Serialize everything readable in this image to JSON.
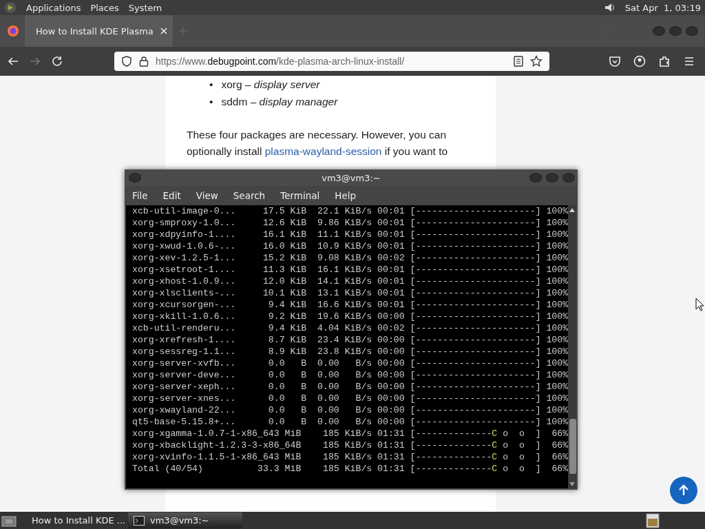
{
  "top_panel": {
    "menus": [
      "Applications",
      "Places",
      "System"
    ],
    "clock": "Sat Apr  1, 03:19"
  },
  "browser": {
    "tabs": [
      {
        "title": "How to Install KDE Plasma",
        "selected": true
      }
    ],
    "url": {
      "prefix": "https://www.",
      "domain": "debugpoint.com",
      "path": "/kde-plasma-arch-linux-install/"
    },
    "forward_disabled": true
  },
  "article": {
    "bullets": [
      {
        "marker": "•",
        "text": "xorg – *display server*"
      },
      {
        "marker": "•",
        "text": "sddm – *display manager*"
      }
    ],
    "paragraph": {
      "before": "These four packages are necessary. However, you can optionally install ",
      "link": "plasma-wayland-session",
      "after": " if you want to"
    }
  },
  "terminal": {
    "title": "vm3@vm3:~",
    "menu": [
      "File",
      "Edit",
      "View",
      "Search",
      "Terminal",
      "Help"
    ],
    "lines": [
      {
        "kind": "done",
        "info": "xcb-util-image-0...     17.5 KiB  22.1 KiB/s 00:01 ",
        "bar": "[----------------------]",
        "percent": " 100%"
      },
      {
        "kind": "done",
        "info": "xorg-smproxy-1.0...     12.6 KiB  9.86 KiB/s 00:01 ",
        "bar": "[----------------------]",
        "percent": " 100%"
      },
      {
        "kind": "done",
        "info": "xorg-xdpyinfo-1....     16.1 KiB  11.1 KiB/s 00:01 ",
        "bar": "[----------------------]",
        "percent": " 100%"
      },
      {
        "kind": "done",
        "info": "xorg-xwud-1.0.6-...     16.0 KiB  10.9 KiB/s 00:01 ",
        "bar": "[----------------------]",
        "percent": " 100%"
      },
      {
        "kind": "done",
        "info": "xorg-xev-1.2.5-1...     15.2 KiB  9.08 KiB/s 00:02 ",
        "bar": "[----------------------]",
        "percent": " 100%"
      },
      {
        "kind": "done",
        "info": "xorg-xsetroot-1....     11.3 KiB  16.1 KiB/s 00:01 ",
        "bar": "[----------------------]",
        "percent": " 100%"
      },
      {
        "kind": "done",
        "info": "xorg-xhost-1.0.9...     12.0 KiB  14.1 KiB/s 00:01 ",
        "bar": "[----------------------]",
        "percent": " 100%"
      },
      {
        "kind": "done",
        "info": "xorg-xlsclients-...     10.1 KiB  13.1 KiB/s 00:01 ",
        "bar": "[----------------------]",
        "percent": " 100%"
      },
      {
        "kind": "done",
        "info": "xorg-xcursorgen-...      9.4 KiB  16.6 KiB/s 00:01 ",
        "bar": "[----------------------]",
        "percent": " 100%"
      },
      {
        "kind": "done",
        "info": "xorg-xkill-1.0.6...      9.2 KiB  19.6 KiB/s 00:00 ",
        "bar": "[----------------------]",
        "percent": " 100%"
      },
      {
        "kind": "done",
        "info": "xcb-util-renderu...      9.4 KiB  4.04 KiB/s 00:02 ",
        "bar": "[----------------------]",
        "percent": " 100%"
      },
      {
        "kind": "done",
        "info": "xorg-xrefresh-1....      8.7 KiB  23.4 KiB/s 00:00 ",
        "bar": "[----------------------]",
        "percent": " 100%"
      },
      {
        "kind": "done",
        "info": "xorg-sessreg-1.1...      8.9 KiB  23.8 KiB/s 00:00 ",
        "bar": "[----------------------]",
        "percent": " 100%"
      },
      {
        "kind": "done",
        "info": "xorg-server-xvfb...      0.0   B  0.00   B/s 00:00 ",
        "bar": "[----------------------]",
        "percent": " 100%"
      },
      {
        "kind": "done",
        "info": "xorg-server-deve...      0.0   B  0.00   B/s 00:00 ",
        "bar": "[----------------------]",
        "percent": " 100%"
      },
      {
        "kind": "done",
        "info": "xorg-server-xeph...      0.0   B  0.00   B/s 00:00 ",
        "bar": "[----------------------]",
        "percent": " 100%"
      },
      {
        "kind": "done",
        "info": "xorg-server-xnes...      0.0   B  0.00   B/s 00:00 ",
        "bar": "[----------------------]",
        "percent": " 100%"
      },
      {
        "kind": "done",
        "info": "xorg-xwayland-22...      0.0   B  0.00   B/s 00:00 ",
        "bar": "[----------------------]",
        "percent": " 100%"
      },
      {
        "kind": "done",
        "info": "qt5-base-5.15.8+...      0.0   B  0.00   B/s 00:00 ",
        "bar": "[----------------------]",
        "percent": " 100%"
      },
      {
        "kind": "progress",
        "info": "xorg-xgamma-1.0.7-1-x86_643 MiB    185 KiB/s 01:31 ",
        "bar": "[--------------",
        "pacman": "C",
        "bar_rest": " o  o  ]",
        "percent": "  66%"
      },
      {
        "kind": "progress",
        "info": "xorg-xbacklight-1.2.3-3-x86_64B    185 KiB/s 01:31 ",
        "bar": "[--------------",
        "pacman": "C",
        "bar_rest": " o  o  ]",
        "percent": "  66%"
      },
      {
        "kind": "progress",
        "info": "xorg-xvinfo-1.1.5-1-x86_643 MiB    185 KiB/s 01:31 ",
        "bar": "[--------------",
        "pacman": "C",
        "bar_rest": " o  o  ]",
        "percent": "  66%"
      },
      {
        "kind": "progress",
        "info": "Total (40/54)          33.3 MiB    185 KiB/s 01:31 ",
        "bar": "[--------------",
        "pacman": "C",
        "bar_rest": " o  o  ]",
        "percent": "  66%"
      }
    ]
  },
  "taskbar": {
    "items": [
      {
        "kind": "browser",
        "label": "How to Install KDE ...",
        "selected": false
      },
      {
        "kind": "terminal",
        "label": "vm3@vm3:~",
        "selected": true
      }
    ]
  }
}
